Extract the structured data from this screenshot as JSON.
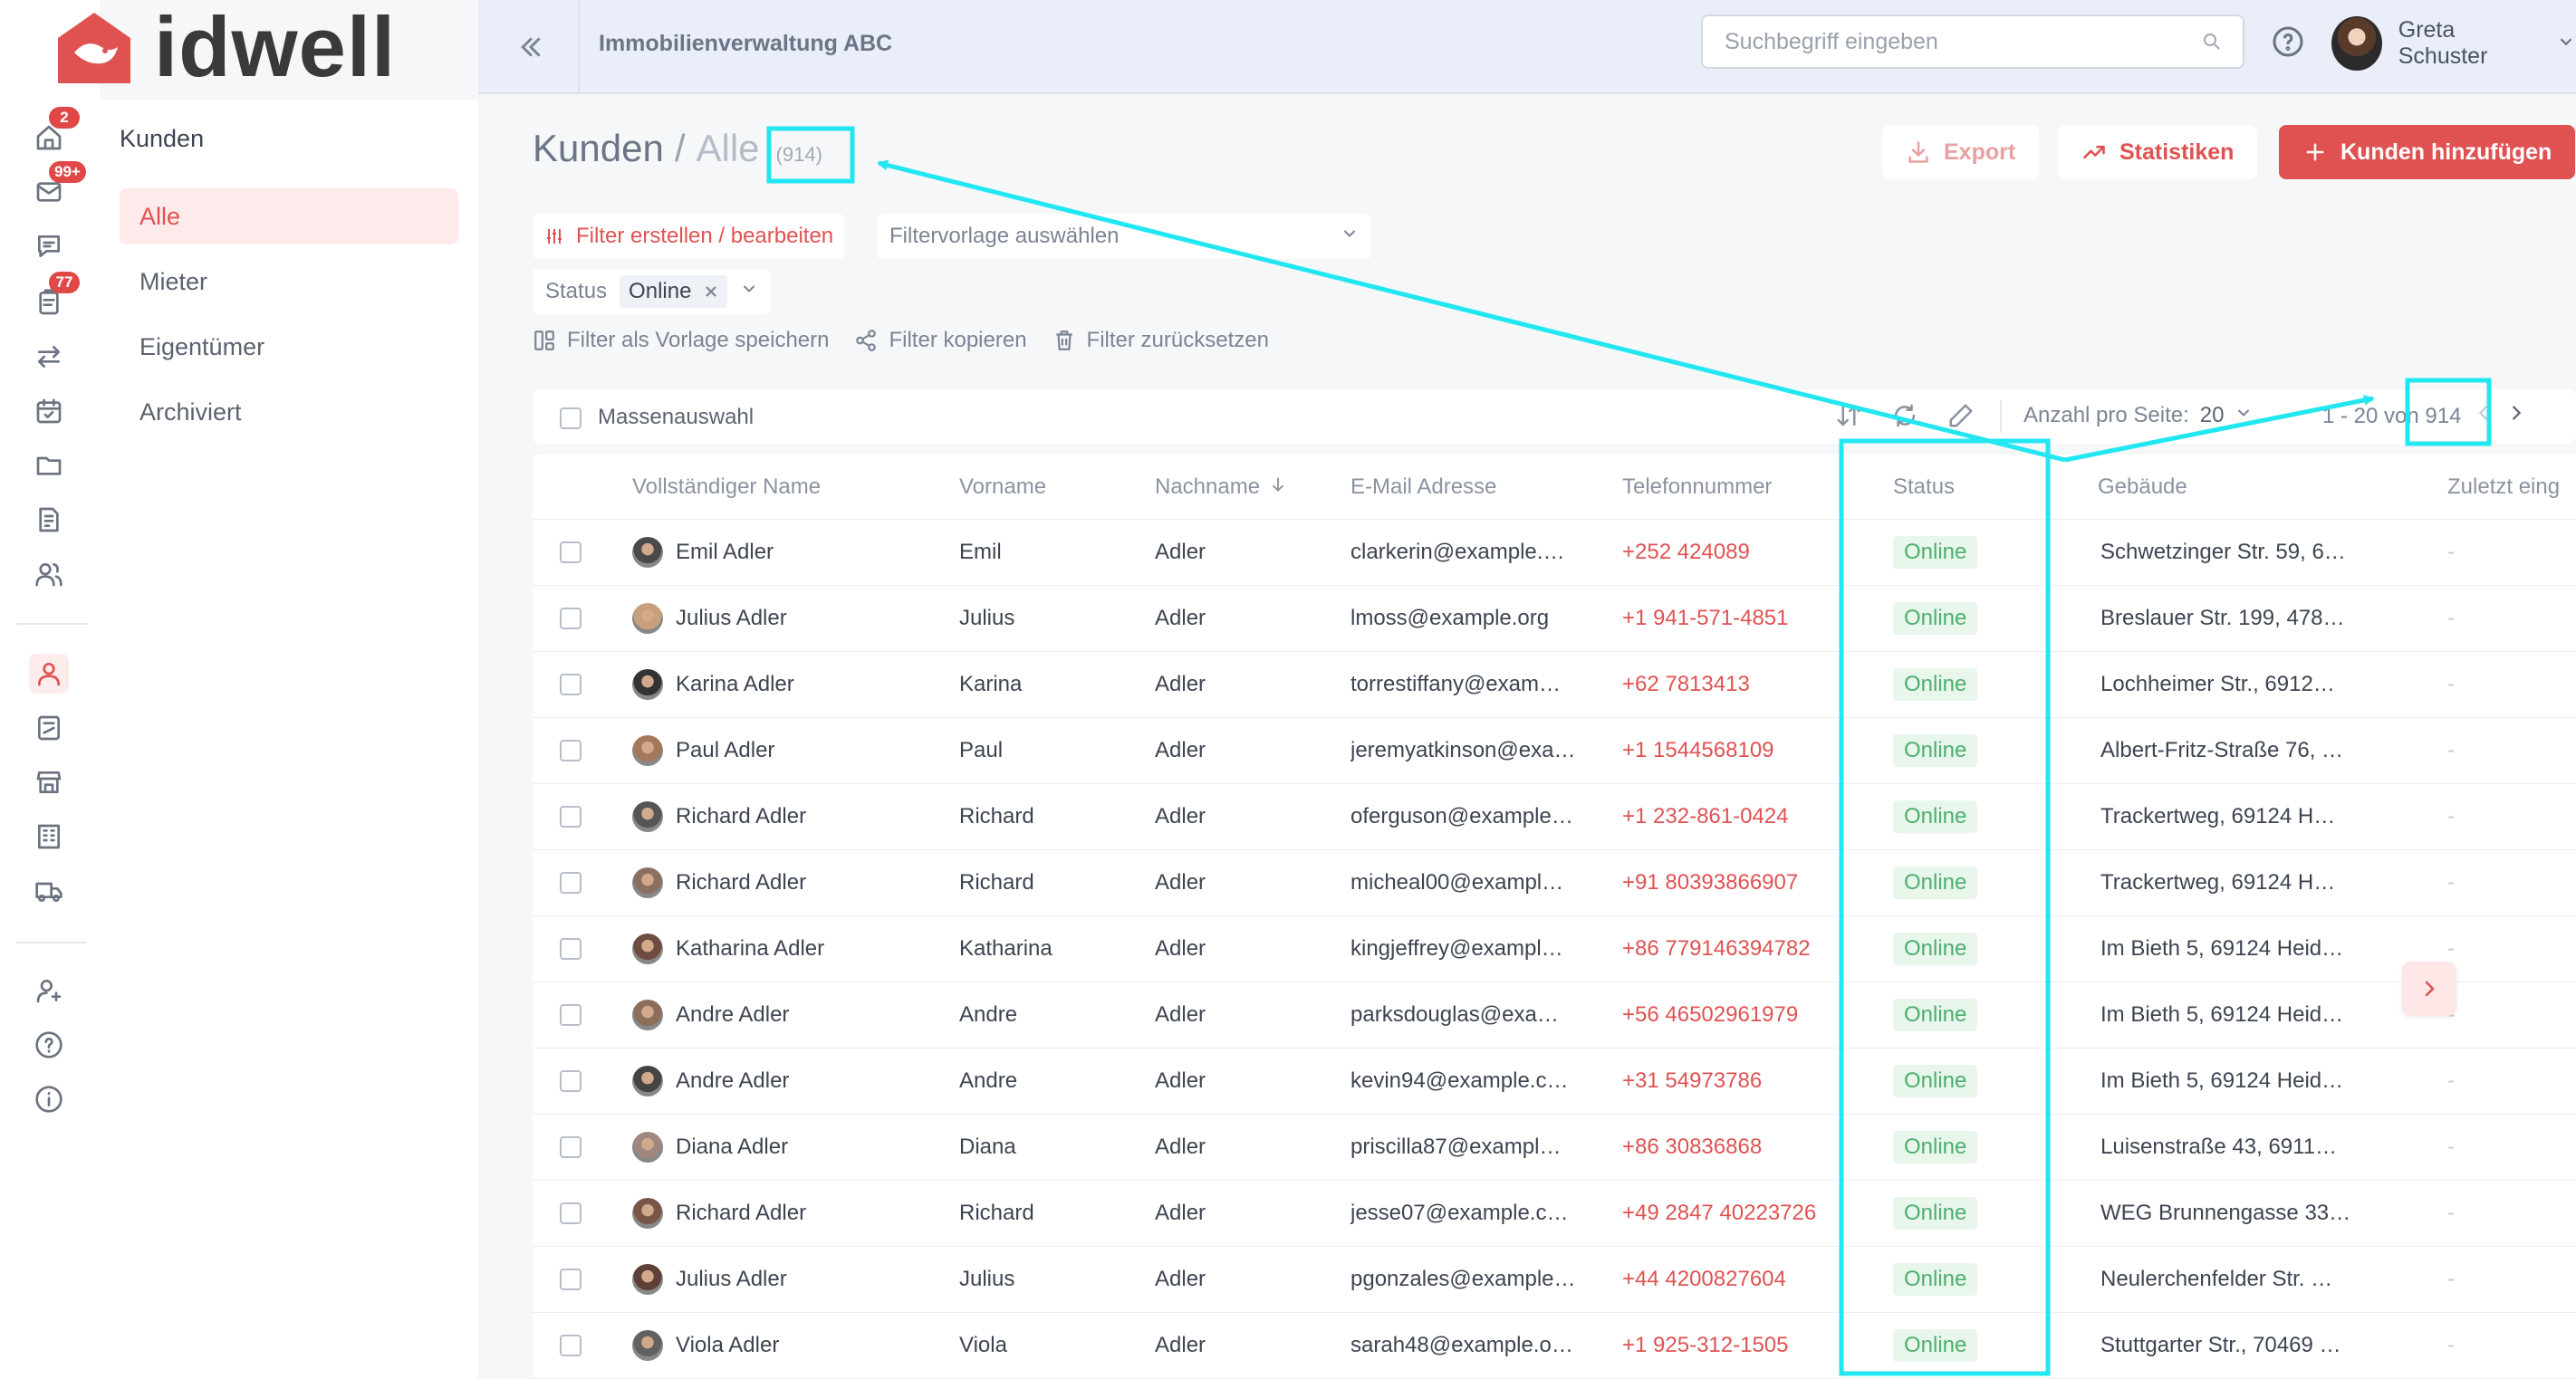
{
  "app": {
    "logo_text": "idwell",
    "org_name": "Immobilienverwaltung ABC",
    "accent": "#e05252"
  },
  "rail": [
    {
      "icon": "home-icon",
      "badge": "2"
    },
    {
      "icon": "mail-icon",
      "badge": "99+"
    },
    {
      "icon": "chat-icon",
      "badge": ""
    },
    {
      "icon": "clipboard-icon",
      "badge": "77"
    },
    {
      "icon": "transfer-icon",
      "badge": ""
    },
    {
      "icon": "calendar-icon",
      "badge": ""
    },
    {
      "icon": "folder-icon",
      "badge": ""
    },
    {
      "icon": "invoice-icon",
      "badge": ""
    },
    {
      "icon": "users-icon",
      "badge": ""
    },
    {
      "icon": "person-icon",
      "badge": "",
      "active": true
    },
    {
      "icon": "contract-icon",
      "badge": ""
    },
    {
      "icon": "store-icon",
      "badge": ""
    },
    {
      "icon": "building-icon",
      "badge": ""
    },
    {
      "icon": "truck-icon",
      "badge": ""
    },
    {
      "icon": "user-settings-icon",
      "badge": ""
    },
    {
      "icon": "help-circle-icon",
      "badge": ""
    },
    {
      "icon": "info-icon",
      "badge": ""
    }
  ],
  "subnav": {
    "title": "Kunden",
    "items": [
      {
        "label": "Alle",
        "active": true
      },
      {
        "label": "Mieter"
      },
      {
        "label": "Eigentümer"
      },
      {
        "label": "Archiviert"
      }
    ]
  },
  "topbar": {
    "search_placeholder": "Suchbegriff eingeben",
    "user_name": "Greta Schuster"
  },
  "header": {
    "title": "Kunden",
    "separator": "/",
    "subtitle": "Alle",
    "count": "(914)",
    "export_label": "Export",
    "stats_label": "Statistiken",
    "add_label": "Kunden hinzufügen"
  },
  "filters": {
    "edit_label": "Filter erstellen / bearbeiten",
    "template_placeholder": "Filtervorlage auswählen",
    "status_label": "Status",
    "status_value": "Online",
    "save_template": "Filter als Vorlage speichern",
    "copy": "Filter kopieren",
    "reset": "Filter zurücksetzen"
  },
  "toolbar": {
    "mass_select": "Massenauswahl",
    "per_page_label": "Anzahl pro Seite:",
    "per_page_value": "20",
    "pager_range": "1 - 20 von 914"
  },
  "table": {
    "columns": [
      "Vollständiger Name",
      "Vorname",
      "Nachname",
      "E-Mail Adresse",
      "Telefonnummer",
      "Status",
      "Gebäude",
      "Zuletzt eing"
    ],
    "rows": [
      {
        "full": "Emil Adler",
        "first": "Emil",
        "last": "Adler",
        "email": "clarkerin@example.…",
        "phone": "+252 424089",
        "status": "Online",
        "building": "Schwetzinger Str. 59, 6…",
        "lastin": "-"
      },
      {
        "full": "Julius Adler",
        "first": "Julius",
        "last": "Adler",
        "email": "lmoss@example.org",
        "phone": "+1 941-571-4851",
        "status": "Online",
        "building": "Breslauer Str. 199, 478…",
        "lastin": "-"
      },
      {
        "full": "Karina Adler",
        "first": "Karina",
        "last": "Adler",
        "email": "torrestiffany@exam…",
        "phone": "+62 7813413",
        "status": "Online",
        "building": "Lochheimer Str., 6912…",
        "lastin": "-"
      },
      {
        "full": "Paul Adler",
        "first": "Paul",
        "last": "Adler",
        "email": "jeremyatkinson@exa…",
        "phone": "+1 1544568109",
        "status": "Online",
        "building": "Albert-Fritz-Straße 76, …",
        "lastin": "-"
      },
      {
        "full": "Richard Adler",
        "first": "Richard",
        "last": "Adler",
        "email": "oferguson@example…",
        "phone": "+1 232-861-0424",
        "status": "Online",
        "building": "Trackertweg, 69124 H…",
        "lastin": "-"
      },
      {
        "full": "Richard Adler",
        "first": "Richard",
        "last": "Adler",
        "email": "micheal00@exampl…",
        "phone": "+91 80393866907",
        "status": "Online",
        "building": "Trackertweg, 69124 H…",
        "lastin": "-"
      },
      {
        "full": "Katharina Adler",
        "first": "Katharina",
        "last": "Adler",
        "email": "kingjeffrey@exampl…",
        "phone": "+86 779146394782",
        "status": "Online",
        "building": "Im Bieth 5, 69124 Heid…",
        "lastin": "-"
      },
      {
        "full": "Andre Adler",
        "first": "Andre",
        "last": "Adler",
        "email": "parksdouglas@exa…",
        "phone": "+56 46502961979",
        "status": "Online",
        "building": "Im Bieth 5, 69124 Heid…",
        "lastin": "-"
      },
      {
        "full": "Andre Adler",
        "first": "Andre",
        "last": "Adler",
        "email": "kevin94@example.c…",
        "phone": "+31 54973786",
        "status": "Online",
        "building": "Im Bieth 5, 69124 Heid…",
        "lastin": "-"
      },
      {
        "full": "Diana Adler",
        "first": "Diana",
        "last": "Adler",
        "email": "priscilla87@exampl…",
        "phone": "+86 30836868",
        "status": "Online",
        "building": "Luisenstraße 43, 6911…",
        "lastin": "-"
      },
      {
        "full": "Richard Adler",
        "first": "Richard",
        "last": "Adler",
        "email": "jesse07@example.c…",
        "phone": "+49 2847 40223726",
        "status": "Online",
        "building": "WEG Brunnengasse 33…",
        "lastin": "-"
      },
      {
        "full": "Julius Adler",
        "first": "Julius",
        "last": "Adler",
        "email": "pgonzales@example…",
        "phone": "+44 4200827604",
        "status": "Online",
        "building": "Neulerchenfelder Str. …",
        "lastin": "-"
      },
      {
        "full": "Viola Adler",
        "first": "Viola",
        "last": "Adler",
        "email": "sarah48@example.o…",
        "phone": "+1 925-312-1505",
        "status": "Online",
        "building": "Stuttgarter Str., 70469 …",
        "lastin": "-"
      }
    ]
  },
  "annotation_color": "#22e6f0"
}
